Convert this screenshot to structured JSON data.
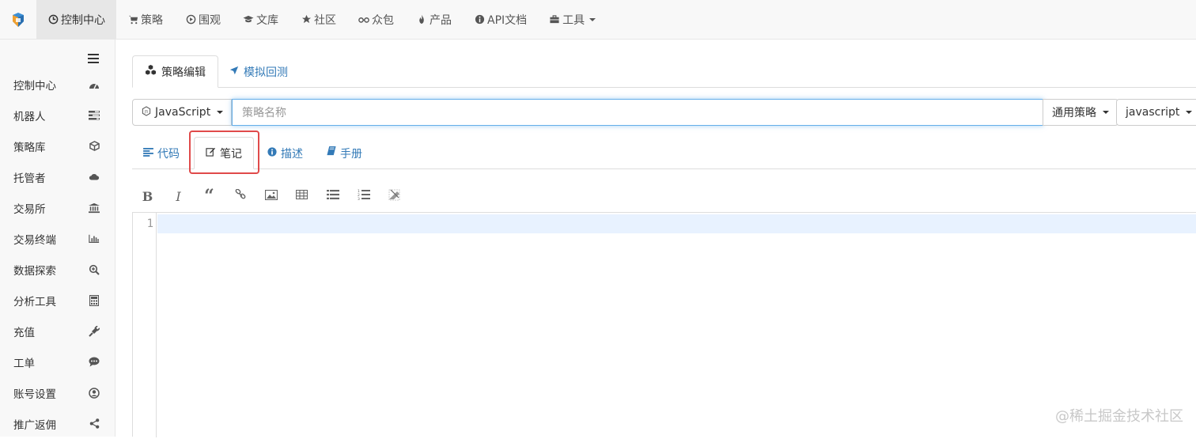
{
  "topnav": {
    "items": [
      {
        "label": "控制中心",
        "icon": "dashboard-icon"
      },
      {
        "label": "策略",
        "icon": "cart-icon"
      },
      {
        "label": "围观",
        "icon": "play-circle-icon"
      },
      {
        "label": "文库",
        "icon": "graduation-cap-icon"
      },
      {
        "label": "社区",
        "icon": "star-icon"
      },
      {
        "label": "众包",
        "icon": "glasses-icon"
      },
      {
        "label": "产品",
        "icon": "fire-icon"
      },
      {
        "label": "API文档",
        "icon": "info-icon"
      },
      {
        "label": "工具",
        "icon": "briefcase-icon"
      }
    ]
  },
  "sidebar": {
    "items": [
      {
        "label": "控制中心",
        "icon": "dashboard-icon"
      },
      {
        "label": "机器人",
        "icon": "tasks-icon"
      },
      {
        "label": "策略库",
        "icon": "cube-icon"
      },
      {
        "label": "托管者",
        "icon": "cloud-icon"
      },
      {
        "label": "交易所",
        "icon": "bank-icon"
      },
      {
        "label": "交易终端",
        "icon": "bar-chart-icon"
      },
      {
        "label": "数据探索",
        "icon": "search-plus-icon"
      },
      {
        "label": "分析工具",
        "icon": "calculator-icon"
      },
      {
        "label": "充值",
        "icon": "plug-icon"
      },
      {
        "label": "工单",
        "icon": "comment-icon"
      },
      {
        "label": "账号设置",
        "icon": "user-circle-icon"
      },
      {
        "label": "推广返佣",
        "icon": "share-icon"
      }
    ]
  },
  "main": {
    "tabs": [
      {
        "label": "策略编辑",
        "icon": "cubes-icon"
      },
      {
        "label": "模拟回测",
        "icon": "rocket-icon"
      }
    ],
    "language_dropdown": "JavaScript",
    "name_placeholder": "策略名称",
    "category_dropdown": "通用策略",
    "mode_dropdown": "javascript",
    "subtabs": [
      {
        "label": "代码",
        "icon": "align-left-icon"
      },
      {
        "label": "笔记",
        "icon": "edit-icon"
      },
      {
        "label": "描述",
        "icon": "info-circle-icon"
      },
      {
        "label": "手册",
        "icon": "book-icon"
      }
    ],
    "toolbar": [
      "bold",
      "italic",
      "quote",
      "link",
      "image",
      "table",
      "unordered-list",
      "ordered-list",
      "clean"
    ],
    "editor": {
      "line_number": "1"
    }
  },
  "watermark": "@稀土掘金技术社区",
  "colors": {
    "link": "#337ab7",
    "highlight": "#e04a4a",
    "focus": "#66afe9"
  }
}
